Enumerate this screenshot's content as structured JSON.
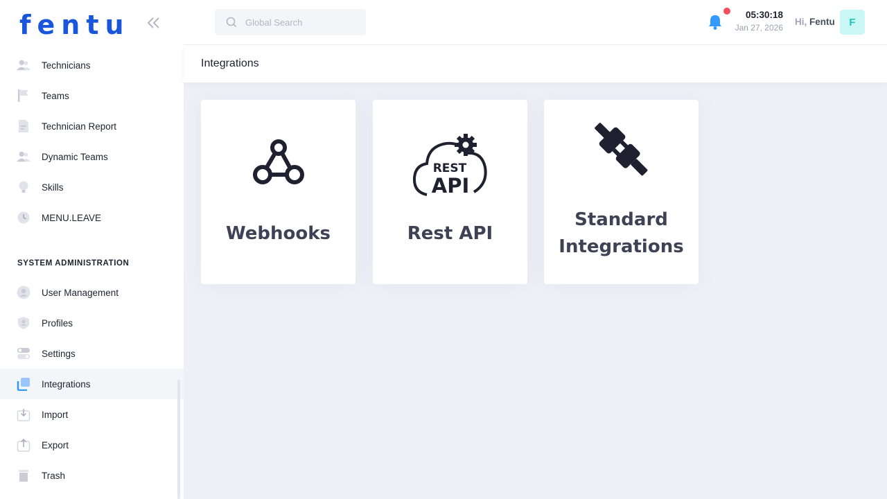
{
  "brand": {
    "name": "fentu",
    "color": "#1a56db"
  },
  "sidebar": {
    "collapse_icon": "double-chevron-left-icon",
    "items_top": [
      {
        "label": "Technicians",
        "icon": "users-icon"
      },
      {
        "label": "Teams",
        "icon": "flag-icon"
      },
      {
        "label": "Technician Report",
        "icon": "report-icon"
      },
      {
        "label": "Dynamic Teams",
        "icon": "users-icon"
      },
      {
        "label": "Skills",
        "icon": "bulb-icon"
      },
      {
        "label": "MENU.LEAVE",
        "icon": "clock-icon"
      }
    ],
    "section_title": "SYSTEM ADMINISTRATION",
    "items_admin": [
      {
        "label": "User Management",
        "icon": "user-circle-icon"
      },
      {
        "label": "Profiles",
        "icon": "shield-user-icon"
      },
      {
        "label": "Settings",
        "icon": "toggle-icon"
      },
      {
        "label": "Integrations",
        "icon": "layers-icon",
        "active": true
      },
      {
        "label": "Import",
        "icon": "import-icon"
      },
      {
        "label": "Export",
        "icon": "export-icon"
      },
      {
        "label": "Trash",
        "icon": "trash-icon"
      }
    ]
  },
  "header": {
    "search": {
      "placeholder": "Global Search",
      "value": "",
      "icon": "search-icon"
    },
    "notification_icon": "bell-icon",
    "time": "05:30:18",
    "date": "Jan 27, 2026",
    "greeting": "Hi,",
    "user_name": "Fentu",
    "avatar_letter": "F"
  },
  "page": {
    "title": "Integrations"
  },
  "cards": [
    {
      "title": "Webhooks",
      "icon": "webhook-icon"
    },
    {
      "title": "Rest API",
      "icon": "rest-api-cloud-icon",
      "icon_text_1": "REST",
      "icon_text_2": "API"
    },
    {
      "title_line1": "Standard",
      "title_line2": "Integrations",
      "icon": "plug-icon"
    }
  ],
  "colors": {
    "accent": "#1a56db",
    "notification_dot": "#f64e60",
    "avatar_bg": "#c9f7f5",
    "avatar_fg": "#1bc5bd",
    "bell": "#3699ff"
  }
}
